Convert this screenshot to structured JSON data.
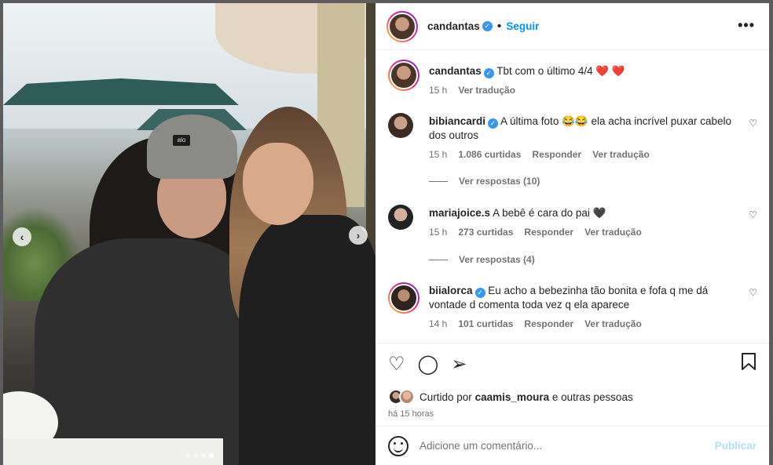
{
  "post": {
    "author": "candantas",
    "follow_label": "Seguir",
    "more_label": "•••",
    "caption": "Tbt com o último 4/4",
    "caption_hearts": "❤️ ❤️",
    "caption_time": "15 h",
    "caption_translate": "Ver tradução",
    "photo_logo": "alo"
  },
  "comments": [
    {
      "user": "bibiancardi",
      "verified": true,
      "text": "A última foto 😂😂 ela acha incrível puxar cabelo dos outros",
      "time": "15 h",
      "likes": "1.086 curtidas",
      "reply": "Responder",
      "translate": "Ver tradução",
      "replies": "Ver respostas (10)"
    },
    {
      "user": "mariajoice.s",
      "verified": false,
      "text": "A bebê é cara do pai 🖤",
      "time": "15 h",
      "likes": "273 curtidas",
      "reply": "Responder",
      "translate": "Ver tradução",
      "replies": "Ver respostas (4)"
    },
    {
      "user": "biialorca",
      "verified": true,
      "text": "Eu acho a bebezinha tão bonita e fofa q me dá vontade d comenta toda vez q ela aparece",
      "time": "14 h",
      "likes": "101 curtidas",
      "reply": "Responder",
      "translate": "Ver tradução"
    }
  ],
  "actions": {
    "liked_prefix": "Curtido por",
    "liked_user": "caamis_moura",
    "liked_suffix": "e outras pessoas",
    "posted_ago": "há 15 horas"
  },
  "add_comment": {
    "placeholder": "Adicione um comentário...",
    "publish_label": "Publicar"
  },
  "icons": [
    "heart-icon",
    "comment-icon",
    "share-icon",
    "bookmark-icon",
    "emoji-icon",
    "chevron-left-icon",
    "chevron-right-icon",
    "verified-icon"
  ],
  "colors": {
    "link": "#0095f6",
    "muted": "#737373",
    "publish_disabled": "#b2dffc",
    "verified": "#3897f0"
  }
}
